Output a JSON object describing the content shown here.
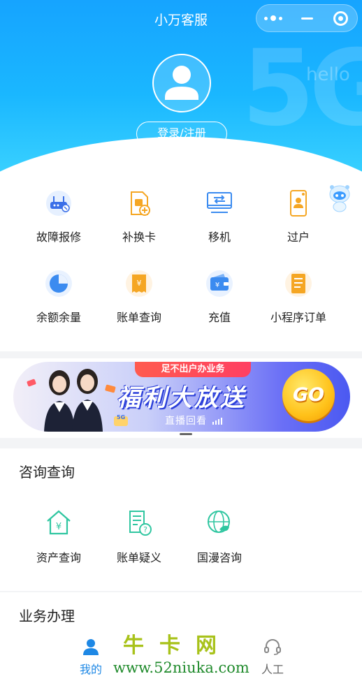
{
  "header": {
    "title": "小万客服",
    "login_button": "登录/注册",
    "watermark_5g": "5G",
    "watermark_hello": "hello"
  },
  "capsule": {
    "more_icon": "more-dots-icon",
    "minimize_icon": "minimize-icon",
    "close_icon": "target-close-icon"
  },
  "services": [
    {
      "label": "故障报修",
      "icon": "router-repair-icon"
    },
    {
      "label": "补换卡",
      "icon": "sim-card-add-icon"
    },
    {
      "label": "移机",
      "icon": "monitor-transfer-icon"
    },
    {
      "label": "过户",
      "icon": "phone-transfer-user-icon"
    },
    {
      "label": "余额余量",
      "icon": "pie-chart-icon"
    },
    {
      "label": "账单查询",
      "icon": "bill-yuan-icon"
    },
    {
      "label": "充值",
      "icon": "wallet-yuan-icon"
    },
    {
      "label": "小程序订单",
      "icon": "order-list-icon"
    }
  ],
  "banner": {
    "ribbon": "足不出户办业务",
    "title": "福利大放送",
    "subtitle": "直播回看",
    "go": "GO"
  },
  "consult": {
    "title": "咨询查询",
    "items": [
      {
        "label": "资产查询",
        "icon": "house-yuan-icon"
      },
      {
        "label": "账单疑义",
        "icon": "bill-question-icon"
      },
      {
        "label": "国漫咨询",
        "icon": "globe-roaming-icon"
      }
    ]
  },
  "business": {
    "title": "业务办理"
  },
  "tabbar": {
    "tabs": [
      {
        "label": "我的",
        "icon": "user-icon",
        "active": true
      },
      {
        "label": "人工",
        "icon": "headset-icon",
        "active": false
      }
    ]
  },
  "site_watermark": {
    "line1": "牛卡网",
    "line2": "www.52niuka.com"
  },
  "colors": {
    "primary": "#1ab0ff",
    "accent_orange": "#f5a623",
    "icon_blue": "#3b8bf0",
    "icon_green": "#2fc6a0",
    "active_tab": "#1e88e5"
  }
}
